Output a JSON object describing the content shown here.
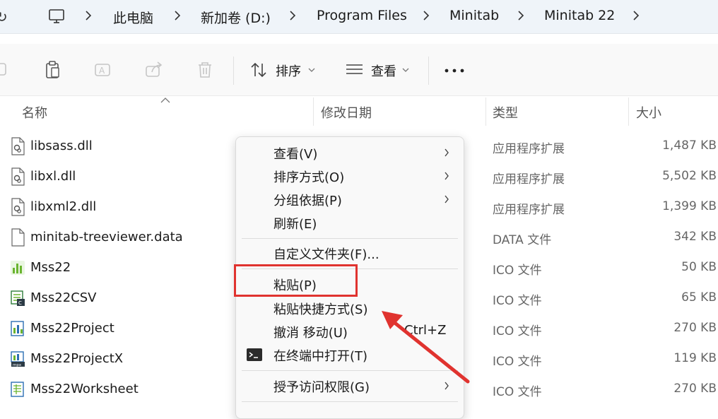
{
  "breadcrumb": {
    "items": [
      "此电脑",
      "新加卷 (D:)",
      "Program Files",
      "Minitab",
      "Minitab 22"
    ]
  },
  "toolbar": {
    "sort_label": "排序",
    "view_label": "查看"
  },
  "columns": {
    "name": "名称",
    "modified": "修改日期",
    "type": "类型",
    "size": "大小"
  },
  "files": [
    {
      "name": "libsass.dll",
      "type": "应用程序扩展",
      "size": "1,487 KB",
      "icon": "dll-file-icon"
    },
    {
      "name": "libxl.dll",
      "type": "应用程序扩展",
      "size": "5,502 KB",
      "icon": "dll-file-icon"
    },
    {
      "name": "libxml2.dll",
      "type": "应用程序扩展",
      "size": "1,399 KB",
      "icon": "dll-file-icon"
    },
    {
      "name": "minitab-treeviewer.data",
      "type": "DATA 文件",
      "size": "342 KB",
      "icon": "blank-file-icon"
    },
    {
      "name": "Mss22",
      "type": "ICO 文件",
      "size": "50 KB",
      "icon": "chart-ico-icon"
    },
    {
      "name": "Mss22CSV",
      "type": "ICO 文件",
      "size": "65 KB",
      "icon": "csv-ico-icon"
    },
    {
      "name": "Mss22Project",
      "type": "ICO 文件",
      "size": "270 KB",
      "icon": "project-ico-icon"
    },
    {
      "name": "Mss22ProjectX",
      "type": "ICO 文件",
      "size": "119 KB",
      "icon": "projectx-ico-icon"
    },
    {
      "name": "Mss22Worksheet",
      "type": "ICO 文件",
      "size": "270 KB",
      "icon": "worksheet-ico-icon"
    }
  ],
  "context_menu": {
    "items": [
      {
        "label": "查看(V)",
        "submenu": true
      },
      {
        "label": "排序方式(O)",
        "submenu": true
      },
      {
        "label": "分组依据(P)",
        "submenu": true
      },
      {
        "label": "刷新(E)",
        "submenu": false
      },
      {
        "label": "自定义文件夹(F)...",
        "submenu": false
      },
      {
        "label": "粘贴(P)",
        "submenu": false
      },
      {
        "label": "粘贴快捷方式(S)",
        "submenu": false
      },
      {
        "label": "撤消 移动(U)",
        "submenu": false,
        "shortcut": "Ctrl+Z"
      },
      {
        "label": "在终端中打开(T)",
        "submenu": false,
        "icon": "terminal-icon"
      },
      {
        "label": "授予访问权限(G)",
        "submenu": true
      }
    ]
  },
  "annotation": {
    "highlight_color": "#e0332f",
    "highlighted_item": "粘贴(P)"
  }
}
